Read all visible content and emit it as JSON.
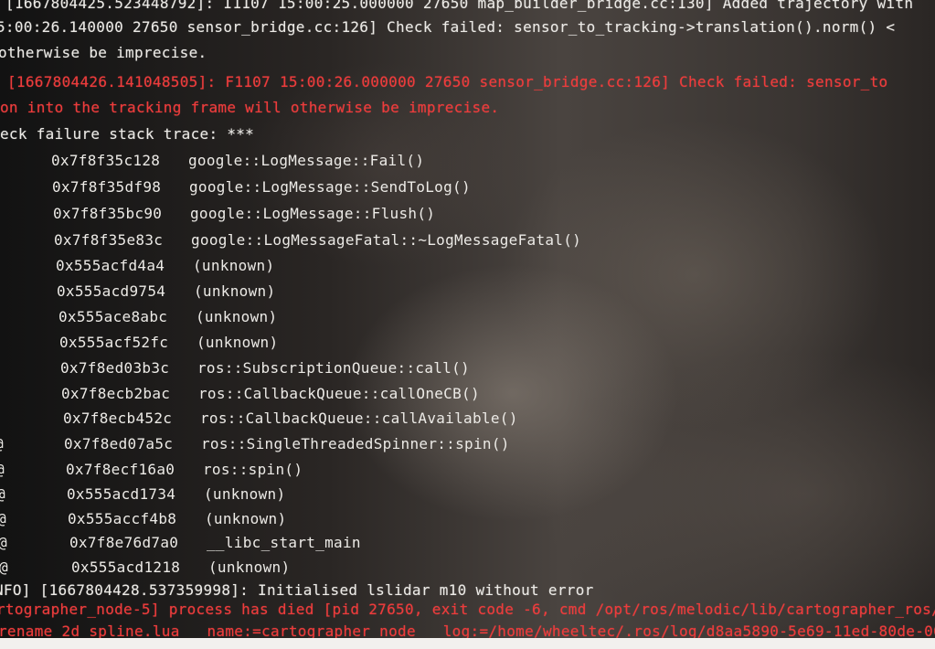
{
  "lines_top": [
    {
      "text": "[1667804425.523448792]: I1107 15:00:25.000000 27650 map_builder_bridge.cc:130] Added trajectory with",
      "color": "white"
    },
    {
      "text": "5:00:26.140000 27650 sensor_bridge.cc:126] Check failed: sensor_to_tracking->translation().norm() <",
      "color": "white"
    },
    {
      "text": "otherwise be imprecise.",
      "color": "white"
    },
    {
      "text": "[1667804426.141048505]: F1107 15:00:26.000000 27650 sensor_bridge.cc:126] Check failed: sensor_to",
      "color": "red"
    },
    {
      "text": "on into the tracking frame will otherwise be imprecise.",
      "color": "red"
    },
    {
      "text": "eck failure stack trace: ***",
      "color": "white"
    }
  ],
  "stack_frames": [
    {
      "prefix": "",
      "addr": "0x7f8f35c128",
      "symbol": "google::LogMessage::Fail()"
    },
    {
      "prefix": "",
      "addr": "0x7f8f35df98",
      "symbol": "google::LogMessage::SendToLog()"
    },
    {
      "prefix": "",
      "addr": "0x7f8f35bc90",
      "symbol": "google::LogMessage::Flush()"
    },
    {
      "prefix": "",
      "addr": "0x7f8f35e83c",
      "symbol": "google::LogMessageFatal::~LogMessageFatal()"
    },
    {
      "prefix": "",
      "addr": "0x555acfd4a4",
      "symbol": "(unknown)"
    },
    {
      "prefix": "",
      "addr": "0x555acd9754",
      "symbol": "(unknown)"
    },
    {
      "prefix": "",
      "addr": "0x555ace8abc",
      "symbol": "(unknown)"
    },
    {
      "prefix": "",
      "addr": "0x555acf52fc",
      "symbol": "(unknown)"
    },
    {
      "prefix": "",
      "addr": "0x7f8ed03b3c",
      "symbol": "ros::SubscriptionQueue::call()"
    },
    {
      "prefix": "",
      "addr": "0x7f8ecb2bac",
      "symbol": "ros::CallbackQueue::callOneCB()"
    },
    {
      "prefix": "",
      "addr": "0x7f8ecb452c",
      "symbol": "ros::CallbackQueue::callAvailable()"
    },
    {
      "prefix": "@",
      "addr": "0x7f8ed07a5c",
      "symbol": "ros::SingleThreadedSpinner::spin()"
    },
    {
      "prefix": "@",
      "addr": "0x7f8ecf16a0",
      "symbol": "ros::spin()"
    },
    {
      "prefix": "@",
      "addr": "0x555acd1734",
      "symbol": "(unknown)"
    },
    {
      "prefix": "@",
      "addr": "0x555accf4b8",
      "symbol": "(unknown)"
    },
    {
      "prefix": "@",
      "addr": "0x7f8e76d7a0",
      "symbol": "__libc_start_main"
    },
    {
      "prefix": "@",
      "addr": "0x555acd1218",
      "symbol": "(unknown)"
    }
  ],
  "lines_bottom": [
    {
      "text": "NFO] [1667804428.537359998]: Initialised lslidar m10 without error",
      "color": "white"
    },
    {
      "text": "rtographer_node-5] process has died [pid 27650, exit code -6, cmd /opt/ros/melodic/lib/cartographer_ros/c",
      "color": "red"
    },
    {
      "text": "rename 2d_spline.lua __name:=cartographer_node __log:=/home/wheeltec/.ros/log/d8aa5890-5e69-11ed-80de-000",
      "color": "red"
    }
  ],
  "colors": {
    "text_white": "#eceae6",
    "text_red": "#ee3b3b"
  }
}
